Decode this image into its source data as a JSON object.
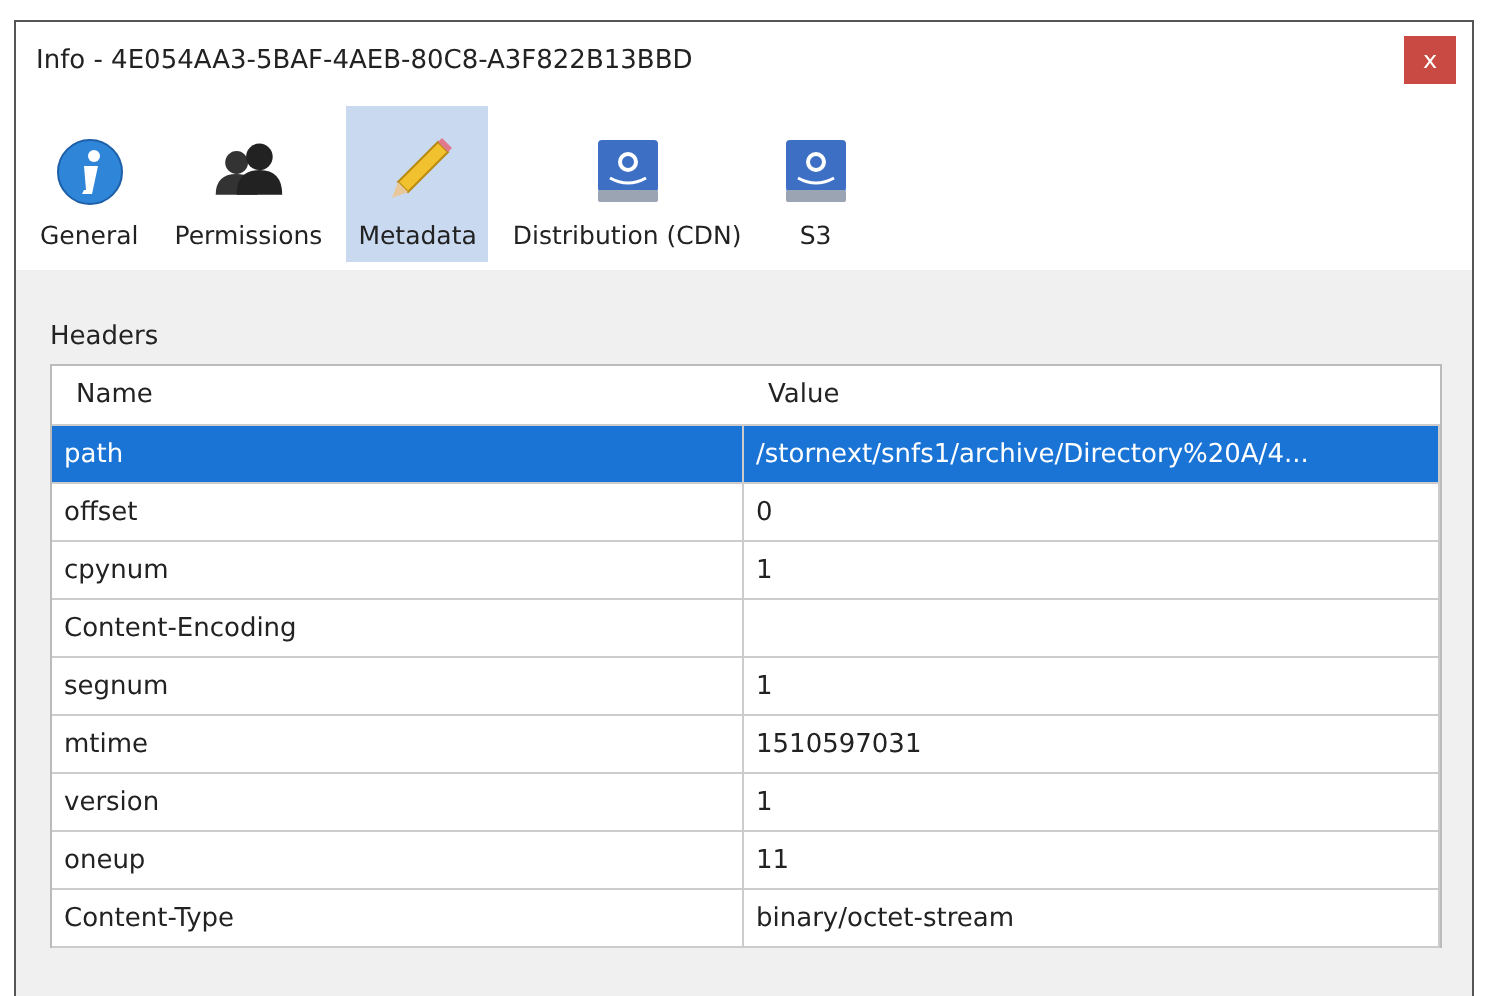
{
  "window": {
    "title": "Info - 4E054AA3-5BAF-4AEB-80C8-A3F822B13BBD",
    "close": "x"
  },
  "tabs": [
    {
      "label": "General",
      "kind": "info",
      "selected": false
    },
    {
      "label": "Permissions",
      "kind": "users",
      "selected": false
    },
    {
      "label": "Metadata",
      "kind": "pencil",
      "selected": true
    },
    {
      "label": "Distribution (CDN)",
      "kind": "storage",
      "selected": false
    },
    {
      "label": "S3",
      "kind": "storage",
      "selected": false
    }
  ],
  "section_label": "Headers",
  "table": {
    "columns": [
      "Name",
      "Value"
    ],
    "rows": [
      {
        "name": "path",
        "value": "/stornext/snfs1/archive/Directory%20A/4...",
        "selected": true
      },
      {
        "name": "offset",
        "value": "0",
        "selected": false
      },
      {
        "name": "cpynum",
        "value": "1",
        "selected": false
      },
      {
        "name": "Content-Encoding",
        "value": "",
        "selected": false
      },
      {
        "name": "segnum",
        "value": "1",
        "selected": false
      },
      {
        "name": "mtime",
        "value": "1510597031",
        "selected": false
      },
      {
        "name": "version",
        "value": "1",
        "selected": false
      },
      {
        "name": "oneup",
        "value": "11",
        "selected": false
      },
      {
        "name": "Content-Type",
        "value": "binary/octet-stream",
        "selected": false
      }
    ]
  }
}
